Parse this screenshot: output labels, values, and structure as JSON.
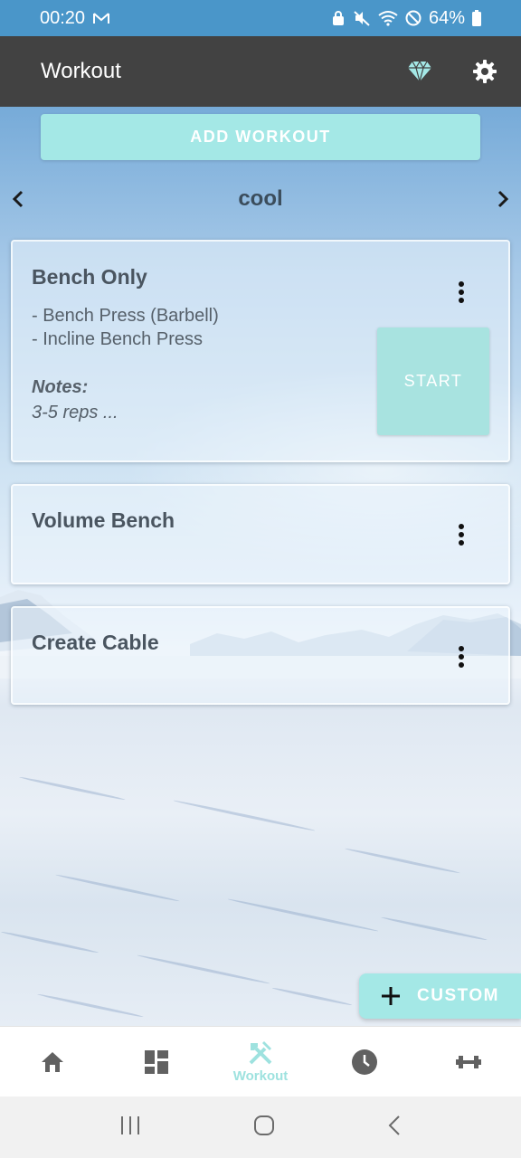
{
  "status_bar": {
    "time": "00:20",
    "battery": "64%"
  },
  "app_bar": {
    "title": "Workout"
  },
  "add_workout_label": "ADD WORKOUT",
  "routine": {
    "name": "cool"
  },
  "workouts": [
    {
      "title": "Bench Only",
      "exercises": [
        "- Bench Press (Barbell)",
        "- Incline Bench Press"
      ],
      "notes_label": "Notes:",
      "notes": "3-5 reps  ...",
      "start_label": "START"
    },
    {
      "title": "Volume Bench"
    },
    {
      "title": "Create Cable"
    }
  ],
  "fab": {
    "label": "CUSTOM"
  },
  "bottom_nav": {
    "items": [
      {
        "icon": "home-icon",
        "label": ""
      },
      {
        "icon": "dashboard-icon",
        "label": ""
      },
      {
        "icon": "tools-icon",
        "label": "Workout",
        "active": true
      },
      {
        "icon": "history-icon",
        "label": ""
      },
      {
        "icon": "dumbbell-icon",
        "label": ""
      }
    ]
  },
  "colors": {
    "accent": "#a4e8e6",
    "app_bar": "#424242",
    "status_bar": "#4a96c9",
    "active_nav": "#9ee2df",
    "inactive_nav": "#616161"
  }
}
